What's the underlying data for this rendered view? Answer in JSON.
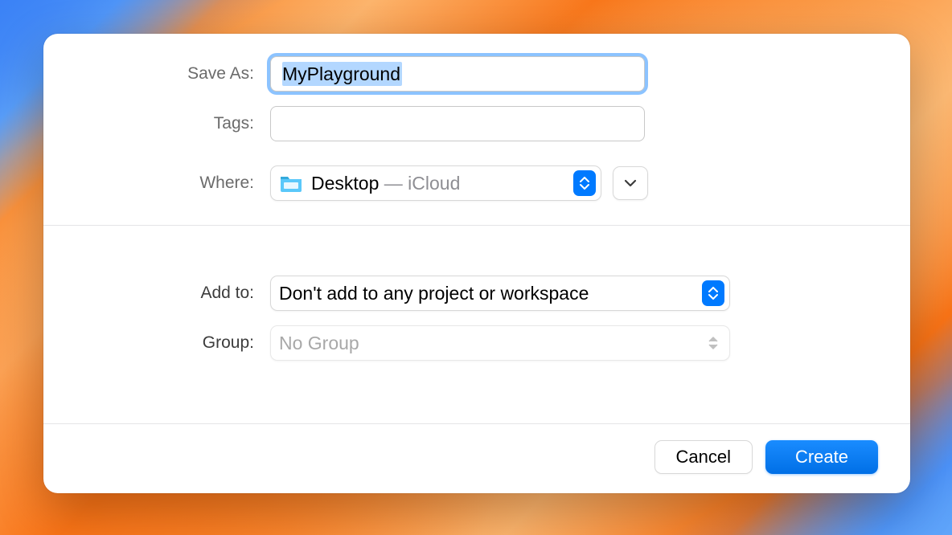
{
  "dialog": {
    "saveAs": {
      "label": "Save As:",
      "value": "MyPlayground"
    },
    "tags": {
      "label": "Tags:",
      "value": ""
    },
    "where": {
      "label": "Where:",
      "location": "Desktop",
      "suffix": " — iCloud"
    },
    "addTo": {
      "label": "Add to:",
      "value": "Don't add to any project or workspace"
    },
    "group": {
      "label": "Group:",
      "value": "No Group"
    },
    "buttons": {
      "cancel": "Cancel",
      "create": "Create"
    }
  }
}
